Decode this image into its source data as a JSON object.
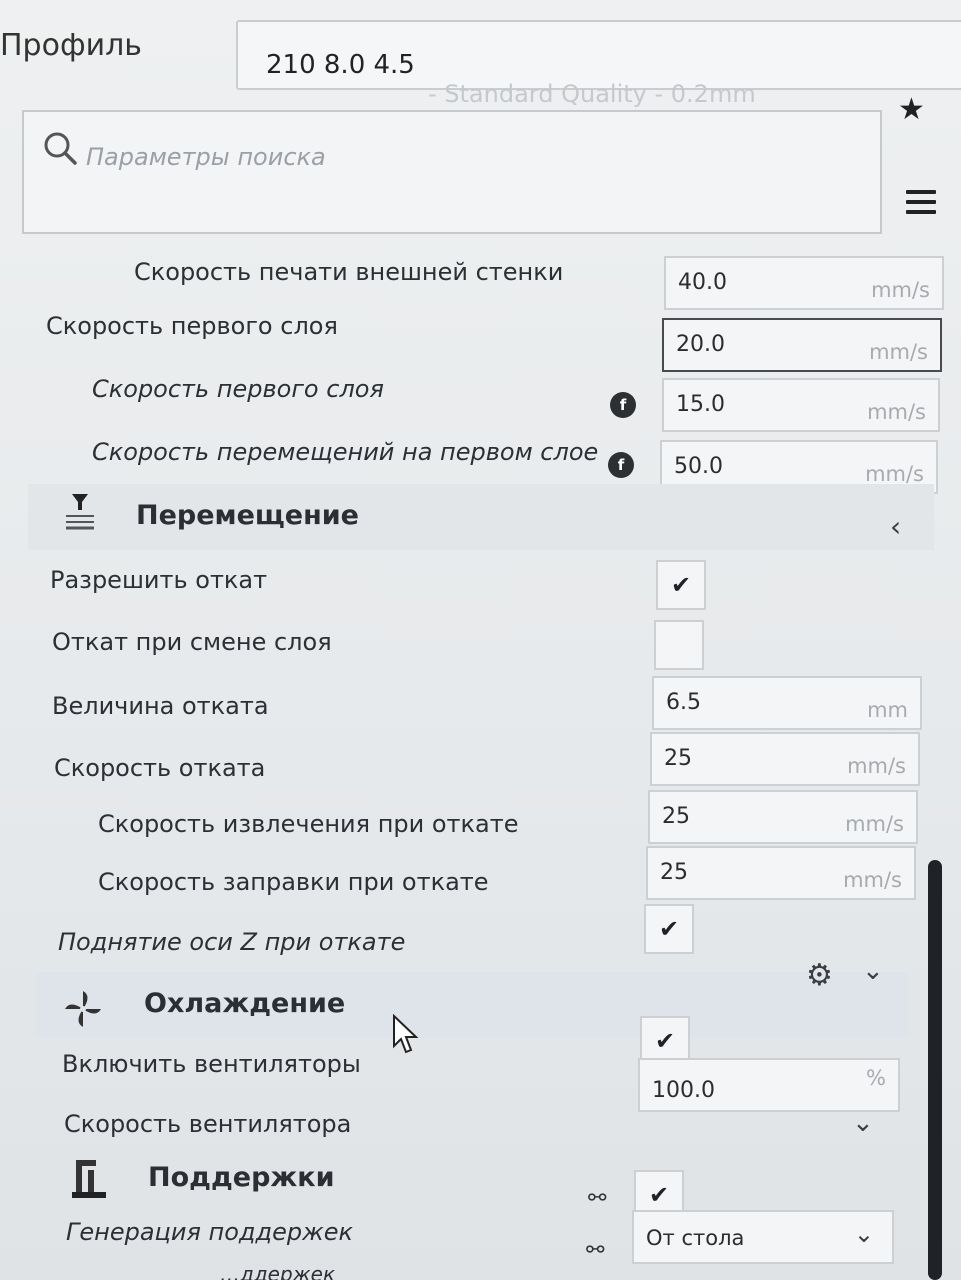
{
  "header": {
    "profile_label": "Профиль",
    "profile_name": "210 8.0 4.5",
    "profile_quality": "- Standard Quality - 0.2mm"
  },
  "search": {
    "placeholder": "Параметры поиска"
  },
  "speed": {
    "outer_wall": {
      "label": "Скорость печати внешней стенки",
      "value": "40.0",
      "unit": "mm/s"
    },
    "initial_layer": {
      "label": "Скорость первого слоя",
      "value": "20.0",
      "unit": "mm/s"
    },
    "initial_layer_print": {
      "label": "Скорость первого слоя",
      "value": "15.0",
      "unit": "mm/s",
      "info": "f"
    },
    "initial_layer_travel": {
      "label": "Скорость перемещений на первом слое",
      "value": "50.0",
      "unit": "mm/s",
      "info": "f"
    }
  },
  "travel": {
    "title": "Перемещение",
    "enable_retraction": {
      "label": "Разрешить откат",
      "checked": "✔"
    },
    "retract_layer_change": {
      "label": "Откат при смене слоя",
      "checked": ""
    },
    "retraction_distance": {
      "label": "Величина отката",
      "value": "6.5",
      "unit": "mm"
    },
    "retraction_speed": {
      "label": "Скорость отката",
      "value": "25",
      "unit": "mm/s"
    },
    "retraction_retract_speed": {
      "label": "Скорость извлечения при откате",
      "value": "25",
      "unit": "mm/s"
    },
    "retraction_prime_speed": {
      "label": "Скорость заправки при откате",
      "value": "25",
      "unit": "mm/s"
    },
    "z_hop": {
      "label": "Поднятие оси Z при откате",
      "checked": "✔"
    }
  },
  "cooling": {
    "title": "Охлаждение",
    "enable_fans": {
      "label": "Включить вентиляторы",
      "checked": "✔"
    },
    "fan_speed": {
      "label": "Скорость вентилятора",
      "value": "100.0",
      "unit": "%"
    }
  },
  "support": {
    "title": "Поддержки",
    "generate": {
      "label": "Генерация поддержек",
      "checked": "✔"
    },
    "placement": {
      "label": "…ддержек",
      "value": "От стола"
    }
  }
}
